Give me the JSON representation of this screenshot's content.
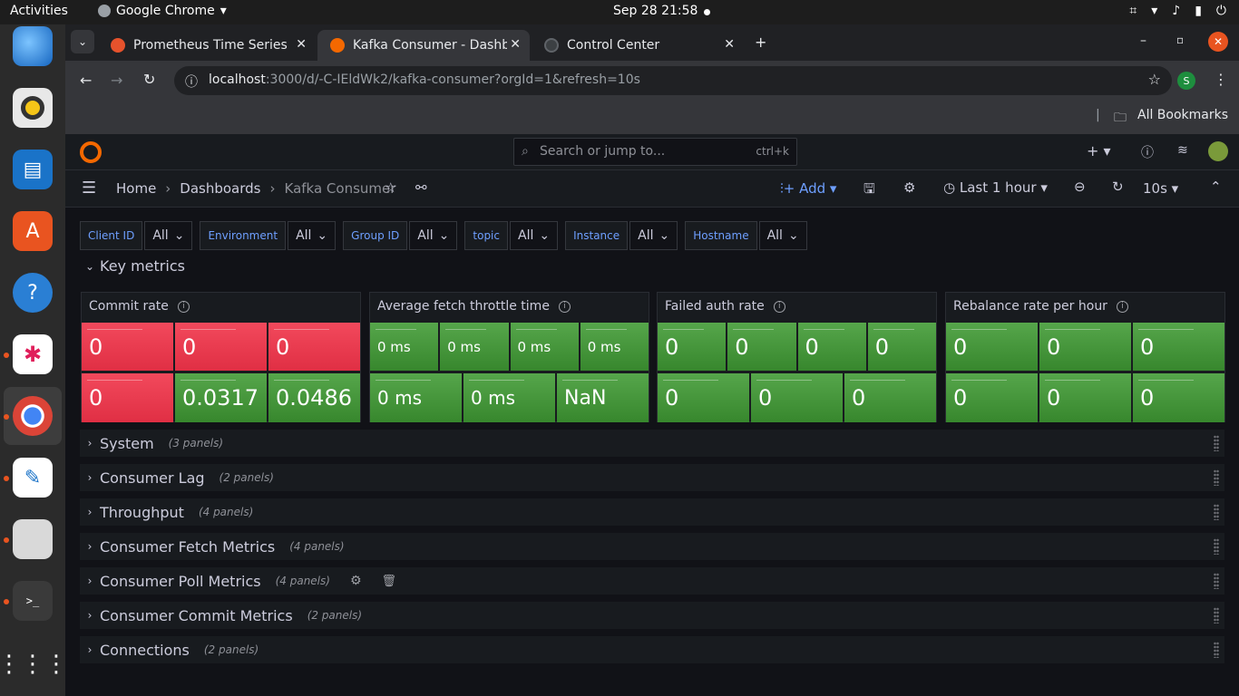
{
  "os": {
    "activities": "Activities",
    "app": "Google Chrome",
    "clock": "Sep 28  21:58"
  },
  "browser": {
    "tabs": [
      {
        "label": "Prometheus Time Series"
      },
      {
        "label": "Kafka Consumer - Dashb"
      },
      {
        "label": "Control Center"
      }
    ],
    "url_host": "localhost",
    "url_rest": ":3000/d/-C-IEldWk2/kafka-consumer?orgId=1&refresh=10s",
    "bookmarks": "All Bookmarks",
    "profile_initial": "S"
  },
  "grafana": {
    "search_placeholder": "Search or jump to...",
    "search_shortcut": "ctrl+k",
    "breadcrumb": [
      "Home",
      "Dashboards",
      "Kafka Consumer"
    ],
    "add_label": "Add",
    "time_range": "Last 1 hour",
    "refresh": "10s"
  },
  "variables": [
    {
      "label": "Client ID",
      "value": "All"
    },
    {
      "label": "Environment",
      "value": "All"
    },
    {
      "label": "Group ID",
      "value": "All"
    },
    {
      "label": "topic",
      "value": "All"
    },
    {
      "label": "Instance",
      "value": "All"
    },
    {
      "label": "Hostname",
      "value": "All"
    }
  ],
  "key_metrics_title": "Key metrics",
  "panels": [
    {
      "title": "Commit rate",
      "row1": [
        {
          "v": "0",
          "c": "red"
        },
        {
          "v": "0",
          "c": "red"
        },
        {
          "v": "0",
          "c": "red"
        }
      ],
      "row2": [
        {
          "v": "0",
          "c": "red"
        },
        {
          "v": "0.0317",
          "c": "green"
        },
        {
          "v": "0.0486",
          "c": "green"
        }
      ]
    },
    {
      "title": "Average fetch throttle time",
      "row1": [
        {
          "v": "0 ms",
          "c": "green"
        },
        {
          "v": "0 ms",
          "c": "green"
        },
        {
          "v": "0 ms",
          "c": "green"
        },
        {
          "v": "0 ms",
          "c": "green"
        }
      ],
      "row2": [
        {
          "v": "0 ms",
          "c": "green"
        },
        {
          "v": "0 ms",
          "c": "green"
        },
        {
          "v": "NaN",
          "c": "green"
        }
      ]
    },
    {
      "title": "Failed auth rate",
      "row1": [
        {
          "v": "0",
          "c": "green"
        },
        {
          "v": "0",
          "c": "green"
        },
        {
          "v": "0",
          "c": "green"
        },
        {
          "v": "0",
          "c": "green"
        }
      ],
      "row2": [
        {
          "v": "0",
          "c": "green"
        },
        {
          "v": "0",
          "c": "green"
        },
        {
          "v": "0",
          "c": "green"
        }
      ]
    },
    {
      "title": "Rebalance rate per hour",
      "row1": [
        {
          "v": "0",
          "c": "green"
        },
        {
          "v": "0",
          "c": "green"
        },
        {
          "v": "0",
          "c": "green"
        }
      ],
      "row2": [
        {
          "v": "0",
          "c": "green"
        },
        {
          "v": "0",
          "c": "green"
        },
        {
          "v": "0",
          "c": "green"
        }
      ]
    }
  ],
  "rows": [
    {
      "title": "System",
      "count": "(3 panels)"
    },
    {
      "title": "Consumer Lag",
      "count": "(2 panels)"
    },
    {
      "title": "Throughput",
      "count": "(4 panels)"
    },
    {
      "title": "Consumer Fetch Metrics",
      "count": "(4 panels)"
    },
    {
      "title": "Consumer Poll Metrics",
      "count": "(4 panels)"
    },
    {
      "title": "Consumer Commit Metrics",
      "count": "(2 panels)"
    },
    {
      "title": "Connections",
      "count": "(2 panels)"
    }
  ],
  "colors": {
    "red": "#e02f44",
    "green": "#37872d",
    "accent": "#6e9fff"
  }
}
